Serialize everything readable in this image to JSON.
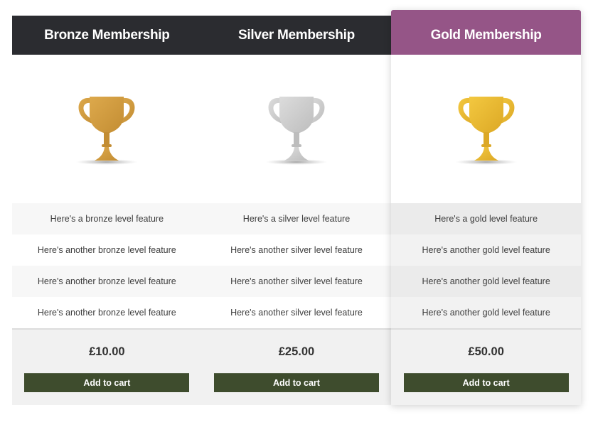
{
  "plans": [
    {
      "name": "Bronze Membership",
      "icon": "trophy-bronze-icon",
      "featured": false,
      "colors": {
        "header": "#2b2c30",
        "trophy": "#dda94c",
        "trophy_dark": "#c38d33"
      },
      "features": [
        "Here's a bronze level feature",
        "Here's another bronze level feature",
        "Here's another bronze level feature",
        "Here's another bronze level feature"
      ],
      "price": "£10.00",
      "button": "Add to cart"
    },
    {
      "name": "Silver Membership",
      "icon": "trophy-silver-icon",
      "featured": false,
      "colors": {
        "header": "#2b2c30",
        "trophy": "#dcdcdc",
        "trophy_dark": "#bdbdbd"
      },
      "features": [
        "Here's a silver level feature",
        "Here's another silver level feature",
        "Here's another silver level feature",
        "Here's another silver level feature"
      ],
      "price": "£25.00",
      "button": "Add to cart"
    },
    {
      "name": "Gold Membership",
      "icon": "trophy-gold-icon",
      "featured": true,
      "colors": {
        "header": "#955587",
        "trophy": "#f3c840",
        "trophy_dark": "#dca825"
      },
      "features": [
        "Here's a gold level feature",
        "Here's another gold level feature",
        "Here's another gold level feature",
        "Here's another gold level feature"
      ],
      "price": "£50.00",
      "button": "Add to cart"
    }
  ],
  "button_color": "#3e4c2d"
}
